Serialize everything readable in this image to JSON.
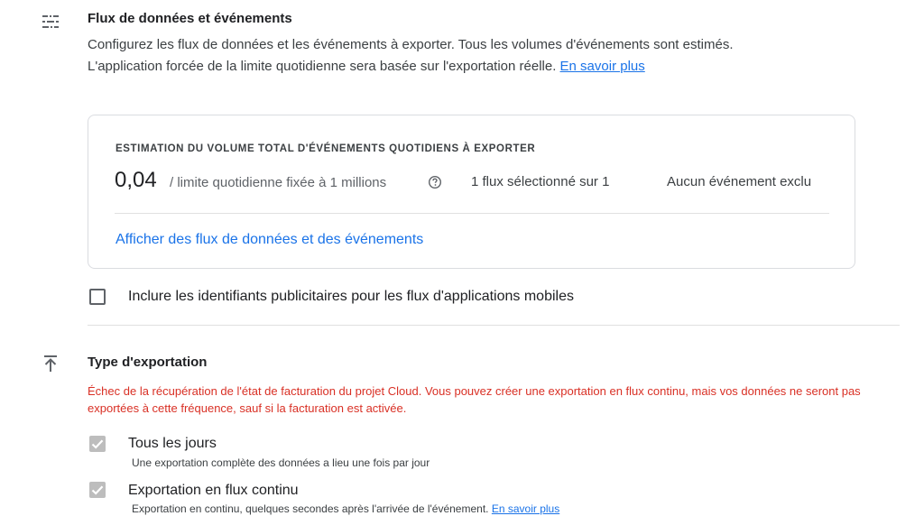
{
  "streams_section": {
    "icon": "list-filter-icon",
    "title": "Flux de données et événements",
    "description": "Configurez les flux de données et les événements à exporter. Tous les volumes d'événements sont estimés. L'application forcée de la limite quotidienne sera basée sur l'exportation réelle.",
    "learn_more_label": "En savoir plus"
  },
  "estimate_card": {
    "heading": "ESTIMATION DU VOLUME TOTAL D'ÉVÉNEMENTS QUOTIDIENS À EXPORTER",
    "value": "0,04",
    "limit_text": "/ limite quotidienne fixée à 1 millions",
    "streams_selected": "1 flux sélectionné sur 1",
    "events_excluded": "Aucun événement exclu",
    "view_link_label": "Afficher des flux de données et des événements"
  },
  "advertising_ids": {
    "label": "Inclure les identifiants publicitaires pour les flux d'applications mobiles",
    "checked": false
  },
  "export_type": {
    "icon": "upload-icon",
    "title": "Type d'exportation",
    "error": "Échec de la récupération de l'état de facturation du projet Cloud. Vous pouvez créer une exportation en flux continu, mais vos données ne seront pas exportées à cette fréquence, sauf si la facturation est activée.",
    "options": [
      {
        "title": "Tous les jours",
        "subtitle": "Une exportation complète des données a lieu une fois par jour",
        "checked": true,
        "disabled": true
      },
      {
        "title": "Exportation en flux continu",
        "subtitle": "Exportation en continu, quelques secondes après l'arrivée de l'événement.",
        "learn_more_label": "En savoir plus",
        "checked": true,
        "disabled": true
      }
    ]
  },
  "colors": {
    "link": "#1a73e8",
    "error": "#d93025",
    "disabled_check": "#bdbdbd"
  }
}
